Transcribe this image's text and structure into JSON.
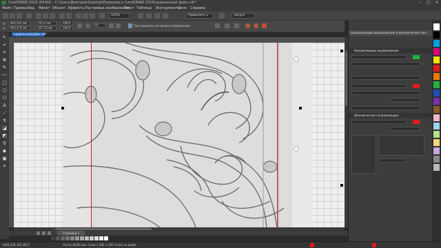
{
  "window": {
    "title": "CorelDRAW 2019 (64-Bit) - C:\\Users\\Дмитрий\\Desktop\\Привязка к CorelDRAW 2019\\правленный файл.cdr*"
  },
  "menu": [
    "Файл",
    "Правка",
    "Вид",
    "Макет",
    "Объект",
    "Эффекты",
    "Растровые изображения",
    "Текст",
    "Таблица",
    "Инструменты",
    "Окно",
    "Справка"
  ],
  "toolbar": {
    "zoom_value": "101%",
    "snap_label": "Привязать к",
    "launch_label": "Запуск"
  },
  "property_bar": {
    "x_value": "463,341 мм",
    "y_value": "903,374 мм",
    "width_value": "215,4 мм",
    "height_value": "207,16 мм",
    "scale_x": "100,0",
    "scale_y": "100,0",
    "rotation": "0,0",
    "trace_label": "Трассировать растровое изображение"
  },
  "document_tab": "правленный файл.cdr*",
  "page_tab": "Страница 1",
  "docker": {
    "title": "Направляющие выравнивания и динамические нап...",
    "align_section": "Направляющие выравнивания",
    "dynamic_section": "Динамические направляющие"
  },
  "status": {
    "coordinates": "(940,218; 921,857)",
    "object_info": "Растр (RGB) вкл. Слой 1 200 × 200 точек на дюйм"
  },
  "colors": {
    "accent": "#2a66b8",
    "toggle_on": "#1fb23a",
    "swatch_red": "#e01c1c",
    "guide_red": "#c81e1e"
  }
}
